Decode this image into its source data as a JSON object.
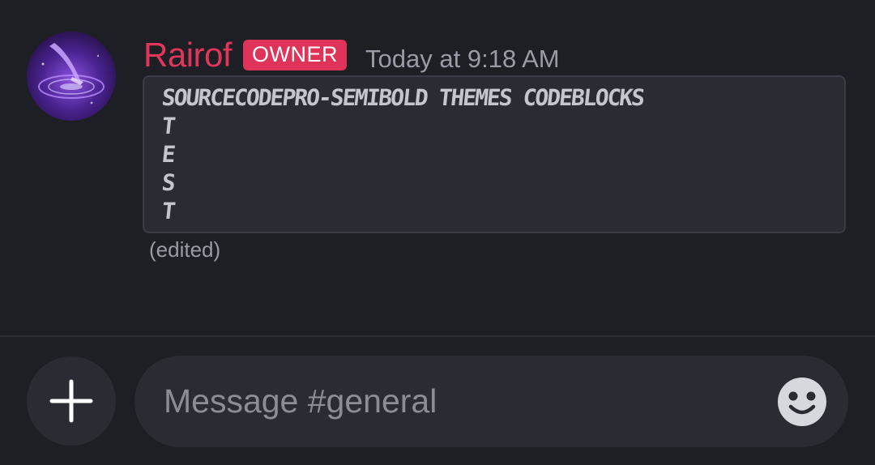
{
  "message": {
    "author": "Rairof",
    "role_badge": "OWNER",
    "timestamp": "Today at 9:18 AM",
    "code_lines": [
      "SOURCECODEPRO-SEMIBOLD THEMES CODEBLOCKS",
      "T",
      "E",
      "S",
      "T"
    ],
    "edited_label": "(edited)"
  },
  "composer": {
    "placeholder": "Message #general"
  },
  "icons": {
    "add": "plus-icon",
    "emoji": "smiley-icon"
  },
  "colors": {
    "background": "#1e1f25",
    "username": "#e0365c",
    "badge": "#df3359",
    "codeblock_bg": "#2a2b33"
  }
}
